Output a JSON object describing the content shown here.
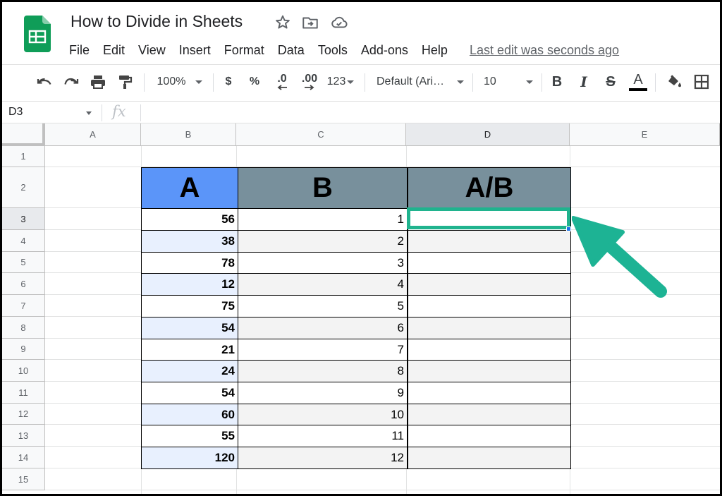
{
  "app": {
    "title": "How to Divide in Sheets",
    "last_edit": "Last edit was seconds ago",
    "menu": [
      "File",
      "Edit",
      "View",
      "Insert",
      "Format",
      "Data",
      "Tools",
      "Add-ons",
      "Help"
    ]
  },
  "toolbar": {
    "zoom": "100%",
    "currency": "$",
    "percent": "%",
    "decrease_decimals": ".0",
    "increase_decimals": ".00",
    "more_formats": "123",
    "font": "Default (Ari…",
    "font_size": "10",
    "bold": "B",
    "italic": "I",
    "strikethrough": "S",
    "text_color": "A"
  },
  "formula_bar": {
    "cell_ref": "D3",
    "fx": "fx",
    "value": ""
  },
  "sheet": {
    "columns": [
      "A",
      "B",
      "C",
      "D",
      "E"
    ],
    "rows": [
      "1",
      "2",
      "3",
      "4",
      "5",
      "6",
      "7",
      "8",
      "9",
      "10",
      "11",
      "12",
      "13",
      "14",
      "15"
    ],
    "active_cell": "D3",
    "table": {
      "headers": [
        "A",
        "B",
        "A/B"
      ],
      "header_colors": [
        "#5b95f9",
        "#78909c",
        "#78909c"
      ],
      "band_colors": {
        "col_a": "#e8f0fe",
        "col_bc": "#f3f3f3"
      },
      "rows": [
        {
          "a": "56",
          "b": "1",
          "ab": ""
        },
        {
          "a": "38",
          "b": "2",
          "ab": ""
        },
        {
          "a": "78",
          "b": "3",
          "ab": ""
        },
        {
          "a": "12",
          "b": "4",
          "ab": ""
        },
        {
          "a": "75",
          "b": "5",
          "ab": ""
        },
        {
          "a": "54",
          "b": "6",
          "ab": ""
        },
        {
          "a": "21",
          "b": "7",
          "ab": ""
        },
        {
          "a": "24",
          "b": "8",
          "ab": ""
        },
        {
          "a": "54",
          "b": "9",
          "ab": ""
        },
        {
          "a": "60",
          "b": "10",
          "ab": ""
        },
        {
          "a": "55",
          "b": "11",
          "ab": ""
        },
        {
          "a": "120",
          "b": "12",
          "ab": ""
        }
      ]
    }
  },
  "colors": {
    "selection": "#20b38e",
    "arrow": "#1db394",
    "sheets_logo": "#0f9d58"
  }
}
